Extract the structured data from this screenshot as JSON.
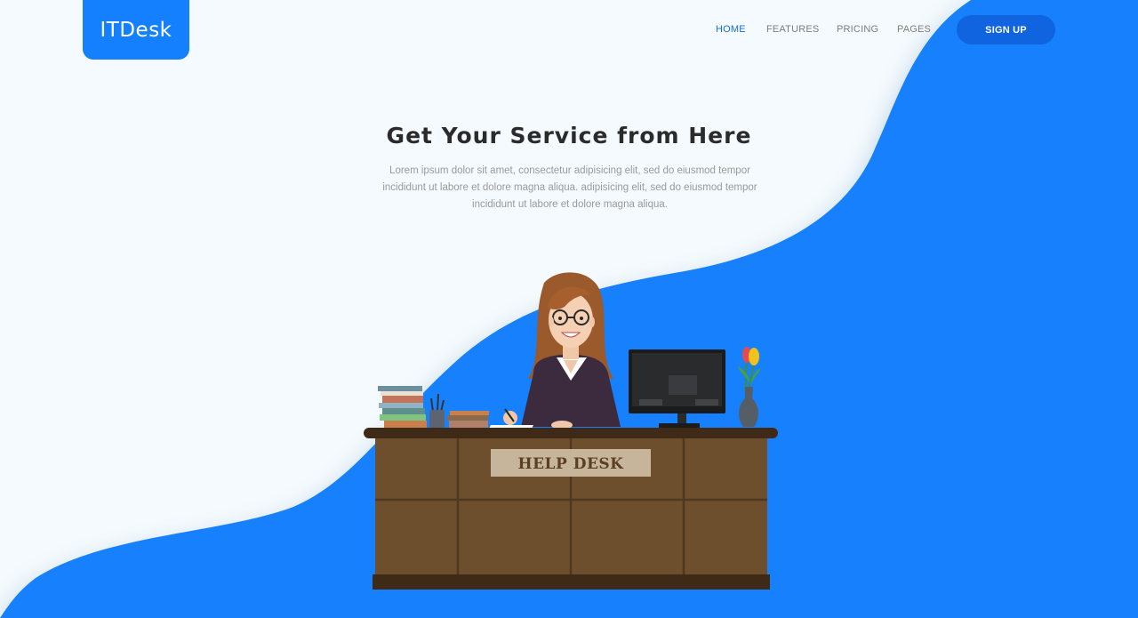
{
  "brand": {
    "logo_text": "ITDesk"
  },
  "nav": {
    "items": [
      {
        "label": "HOME",
        "active": true
      },
      {
        "label": "FEATURES",
        "active": false
      },
      {
        "label": "PRICING",
        "active": false
      },
      {
        "label": "PAGES",
        "active": false
      }
    ],
    "signup_label": "SIGN UP"
  },
  "hero": {
    "title": "Get Your Service from Here",
    "text": "Lorem ipsum dolor sit amet, consectetur adipisicing elit, sed do eiusmod tempor incididunt ut labore et dolore magna aliqua. adipisicing elit, sed do eiusmod tempor incididunt ut labore et dolore magna aliqua."
  },
  "illustration": {
    "desk_sign": "HELP DESK"
  },
  "colors": {
    "brand_blue": "#1480fd",
    "signup_blue": "#1064e0",
    "page_bg": "#f4fafd",
    "nav_active": "#1670d6",
    "desk_brown": "#6e4f2d"
  }
}
